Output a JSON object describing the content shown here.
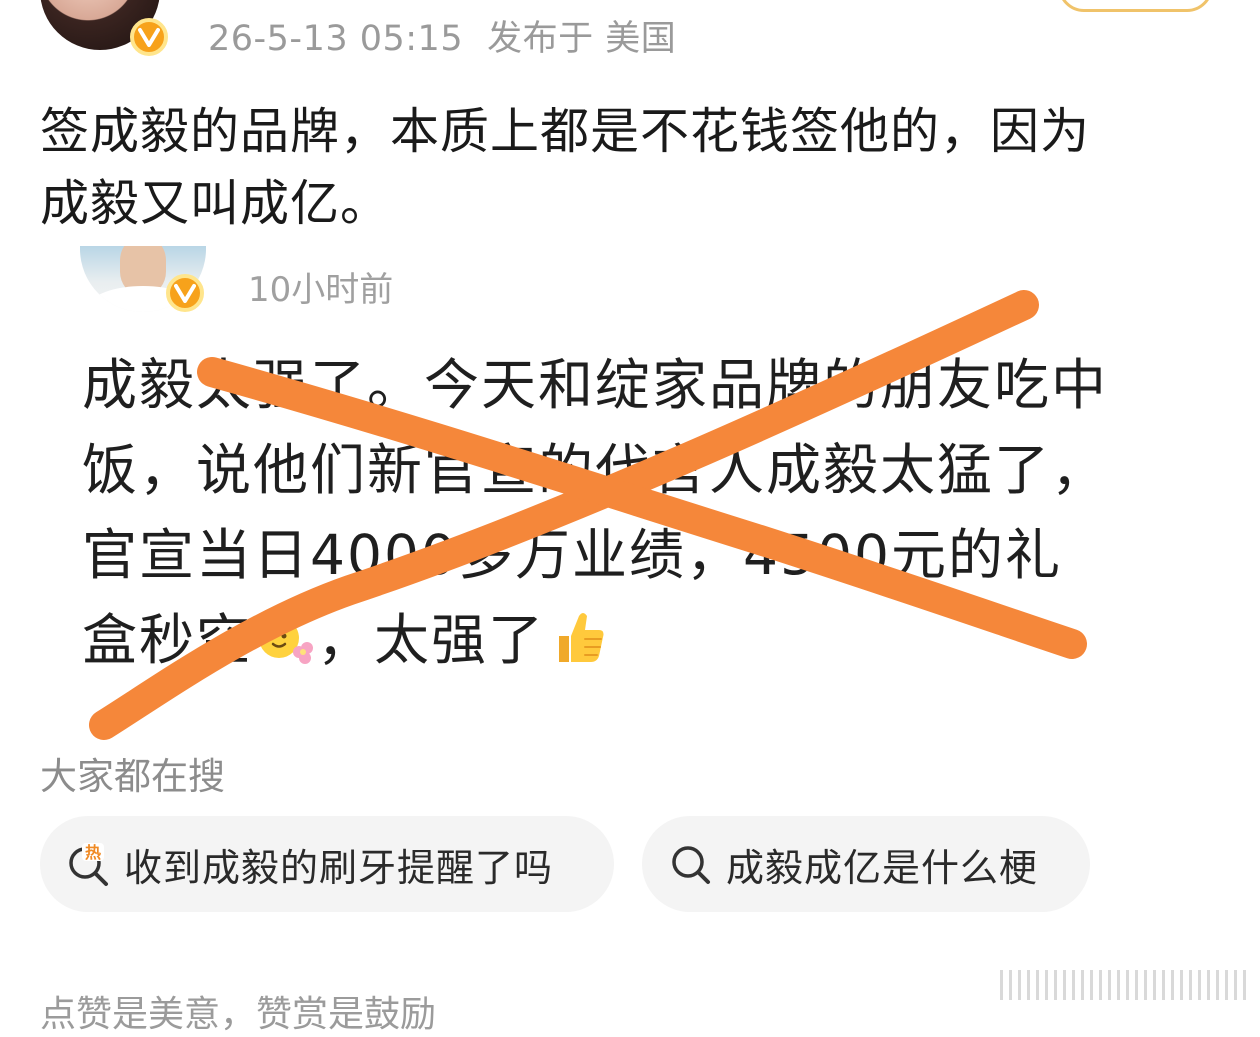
{
  "post": {
    "meta_time": "26-5-13 05:15",
    "meta_location": "发布于 美国",
    "text_line1": "签成毅的品牌，本质上都是不花钱签他的，因为",
    "text_line2": "成毅又叫成亿。"
  },
  "quoted_post": {
    "time": "10小时前",
    "line1": "成毅太强了。今天和绽家品牌的朋友吃中",
    "line2": "饭，说他们新官宣的代言人成毅太猛了，",
    "line3": "官宣当日4000多万业绩，4500元的礼",
    "line4a": "盒秒空",
    "line4b": "，太强了",
    "emoji_1": "flower-face-emoji",
    "emoji_2": "thumbs-up-emoji"
  },
  "search_section": {
    "title": "大家都在搜",
    "chips": [
      {
        "label": "收到成毅的刷牙提醒了吗",
        "icon": "hot-search-icon"
      },
      {
        "label": "成毅成亿是什么梗",
        "icon": "search-icon"
      }
    ]
  },
  "footer": {
    "hint": "点赞是美意，赞赏是鼓励"
  },
  "colors": {
    "cross_stroke": "#f5873a",
    "badge": "#f7a21b",
    "meta_gray": "#9a9a9a"
  }
}
